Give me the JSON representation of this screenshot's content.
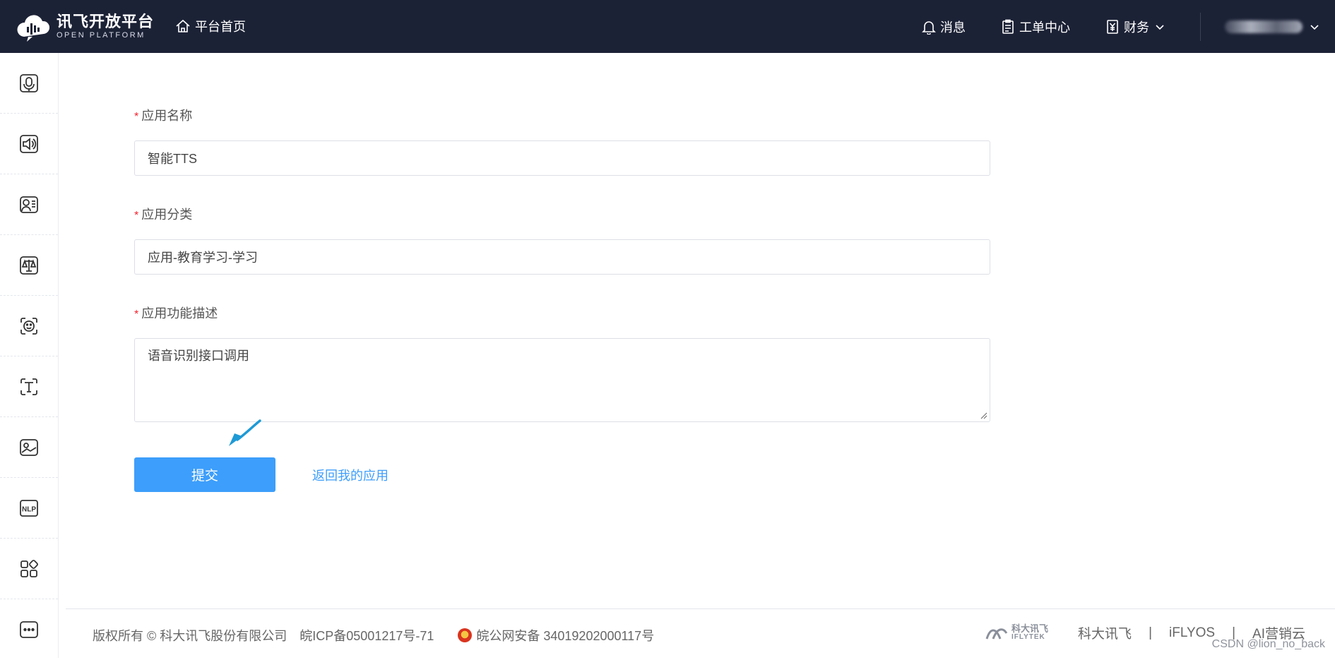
{
  "header": {
    "logo_cn": "讯飞开放平台",
    "logo_en": "OPEN PLATFORM",
    "home_label": "平台首页",
    "messages_label": "消息",
    "tickets_label": "工单中心",
    "finance_label": "财务"
  },
  "sidebar": {
    "items": [
      "mic-icon",
      "speaker-icon",
      "speech-chat-icon",
      "balance-scale-icon",
      "face-icon",
      "text-t-icon",
      "image-icon",
      "nlp-icon",
      "apps-grid-icon",
      "more-icon"
    ],
    "nlp_text": "NLP"
  },
  "form": {
    "required_mark": "*",
    "name_label": "应用名称",
    "name_value": "智能TTS",
    "category_label": "应用分类",
    "category_value": "应用-教育学习-学习",
    "desc_label": "应用功能描述",
    "desc_value": "语音识别接口调用",
    "submit_label": "提交",
    "back_label": "返回我的应用"
  },
  "footer": {
    "copyright": "版权所有 © 科大讯飞股份有限公司",
    "icp": "皖ICP备05001217号-71",
    "police": "皖公网安备 34019202000117号",
    "logo_cn": "科大讯飞",
    "logo_en": "IFLYTEK",
    "links": [
      "科大讯飞",
      "iFLYOS",
      "AI营销云"
    ],
    "sep": "|"
  },
  "watermark": "CSDN @lion_no_back",
  "colors": {
    "header_bg": "#1c2236",
    "primary": "#3d9efb",
    "required": "#f5222d"
  }
}
